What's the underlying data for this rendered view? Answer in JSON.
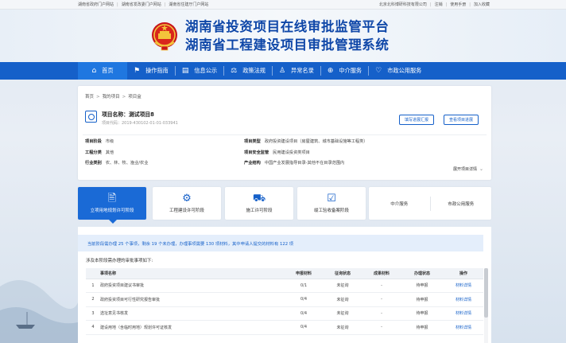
{
  "topbar": {
    "links": [
      "湖南省政府门户网站",
      "湖南省发改委门户网站",
      "湖南省住建厅门户网站"
    ],
    "right": [
      "北京北科博研科技有限公司",
      "注销",
      "使用手册",
      "加入收藏"
    ]
  },
  "header": {
    "title1": "湖南省投资项目在线审批监管平台",
    "title2": "湖南省工程建设项目审批管理系统"
  },
  "nav": [
    {
      "label": "首页",
      "icon": "home-icon"
    },
    {
      "label": "操作指南",
      "icon": "flag-icon"
    },
    {
      "label": "信息公示",
      "icon": "document-icon"
    },
    {
      "label": "政策法规",
      "icon": "scale-icon"
    },
    {
      "label": "异常名录",
      "icon": "user-list-icon"
    },
    {
      "label": "中介服务",
      "icon": "globe-icon"
    },
    {
      "label": "市政公用服务",
      "icon": "heart-icon"
    }
  ],
  "breadcrumb": [
    "首页",
    "我的项目",
    "项目盒"
  ],
  "project": {
    "name": "项目名称：测试项目8",
    "code": "项目代码：2019-430102-01-01-033941",
    "btn_report": "填写进展汇报",
    "btn_progress": "查看项目进展",
    "info": {
      "jianshe_label": "项目阶段",
      "jianshe_value": "市级",
      "area_label": "工程分类",
      "area_value": "其他",
      "industry_label": "行业类别",
      "industry_value": "农、林、牧、渔业/农业",
      "type_label": "项目类型",
      "type_value": "政府投资建设项目（房屋建筑、城市基础设施等工程类）",
      "unit_label": "项目安全监管",
      "unit_value": "民用建设投资类项目",
      "policy_label": "产业结构",
      "policy_value": "中国产业发展指导目录-其他不在目录范围内"
    },
    "more": "展开项目详情"
  },
  "stages": [
    {
      "label": "立项用地规划许可阶段",
      "icon": "stamp-icon",
      "active": true
    },
    {
      "label": "工程建设许可阶段",
      "icon": "gears-icon",
      "active": false
    },
    {
      "label": "施工许可阶段",
      "icon": "crane-icon",
      "active": false
    },
    {
      "label": "竣工验收备案阶段",
      "icon": "checklist-icon",
      "active": false
    }
  ],
  "stage_pair": [
    "中介服务",
    "市政公用服务"
  ],
  "notice": "当前阶段需办理 25 个事项，剩余 19 个未办理，办理事项需要 130 项材料，其中申请人提交的材料有 122 项",
  "subtitle": "涉及本阶段需办理的审批事项如下:",
  "table": {
    "headers": [
      "事项名称",
      "申报材料",
      "征询状态",
      "成果材料",
      "办理状态",
      "操作"
    ],
    "rows": [
      {
        "no": "1",
        "name": "政府投资项目建议书审批",
        "material": "0/1",
        "consult": "未征询",
        "result": "-",
        "status": "待申报",
        "op": "材料详情"
      },
      {
        "no": "2",
        "name": "政府投资项目可行性研究报告审批",
        "material": "0/4",
        "consult": "未征询",
        "result": "-",
        "status": "待申报",
        "op": "材料详情"
      },
      {
        "no": "3",
        "name": "选址意见书核发",
        "material": "0/4",
        "consult": "未征询",
        "result": "-",
        "status": "待申报",
        "op": "材料详情"
      },
      {
        "no": "4",
        "name": "建设用地（含临时用地）规划许可证核发",
        "material": "0/4",
        "consult": "未征询",
        "result": "-",
        "status": "待申报",
        "op": "材料详情"
      }
    ]
  }
}
